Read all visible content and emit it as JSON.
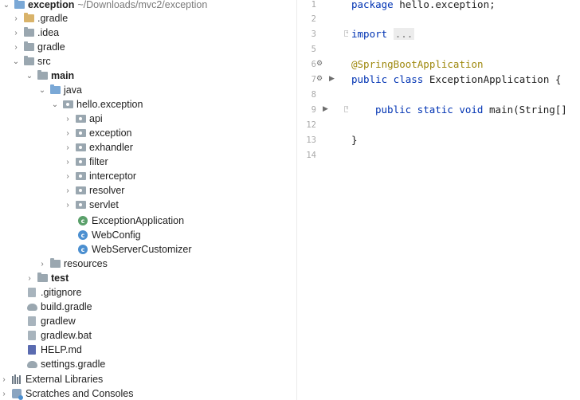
{
  "project": {
    "name": "exception",
    "path": "~/Downloads/mvc2/exception"
  },
  "tree": [
    {
      "label": ".gradle",
      "icon": "folder-yellow",
      "chevron": "right"
    },
    {
      "label": ".idea",
      "icon": "folder",
      "chevron": "right"
    },
    {
      "label": "gradle",
      "icon": "folder",
      "chevron": "right"
    },
    {
      "label": "src",
      "icon": "folder",
      "chevron": "down"
    },
    {
      "label": "main",
      "icon": "folder",
      "chevron": "down"
    },
    {
      "label": "java",
      "icon": "folder-blue",
      "chevron": "down"
    },
    {
      "label": "hello.exception",
      "icon": "package",
      "chevron": "down"
    },
    {
      "label": "api",
      "icon": "package",
      "chevron": "right"
    },
    {
      "label": "exception",
      "icon": "package",
      "chevron": "right"
    },
    {
      "label": "exhandler",
      "icon": "package",
      "chevron": "right"
    },
    {
      "label": "filter",
      "icon": "package",
      "chevron": "right"
    },
    {
      "label": "interceptor",
      "icon": "package",
      "chevron": "right"
    },
    {
      "label": "resolver",
      "icon": "package",
      "chevron": "right"
    },
    {
      "label": "servlet",
      "icon": "package",
      "chevron": "right"
    },
    {
      "label": "ExceptionApplication",
      "icon": "spring-class"
    },
    {
      "label": "WebConfig",
      "icon": "class"
    },
    {
      "label": "WebServerCustomizer",
      "icon": "class"
    },
    {
      "label": "resources",
      "icon": "folder",
      "chevron": "right"
    },
    {
      "label": "test",
      "icon": "folder",
      "chevron": "right"
    },
    {
      "label": ".gitignore",
      "icon": "file"
    },
    {
      "label": "build.gradle",
      "icon": "gradle"
    },
    {
      "label": "gradlew",
      "icon": "file"
    },
    {
      "label": "gradlew.bat",
      "icon": "file"
    },
    {
      "label": "HELP.md",
      "icon": "markdown"
    },
    {
      "label": "settings.gradle",
      "icon": "gradle"
    },
    {
      "label": "External Libraries",
      "icon": "libraries",
      "chevron": "right"
    },
    {
      "label": "Scratches and Consoles",
      "icon": "scratches",
      "chevron": "right"
    }
  ],
  "editor": {
    "line_numbers": [
      "1",
      "2",
      "3",
      "5",
      "6",
      "7",
      "8",
      "9",
      "12",
      "13",
      "14"
    ],
    "code": {
      "l1_kw": "package",
      "l1_rest": " hello.exception;",
      "l3_kw": "import",
      "l3_fold": "...",
      "l6_ann": "@SpringBootApplication",
      "l7_kw": "public class",
      "l7_rest": " ExceptionApplication {",
      "l9_kw": "public static void",
      "l9_rest": " main(String[]",
      "l13": "}"
    }
  }
}
